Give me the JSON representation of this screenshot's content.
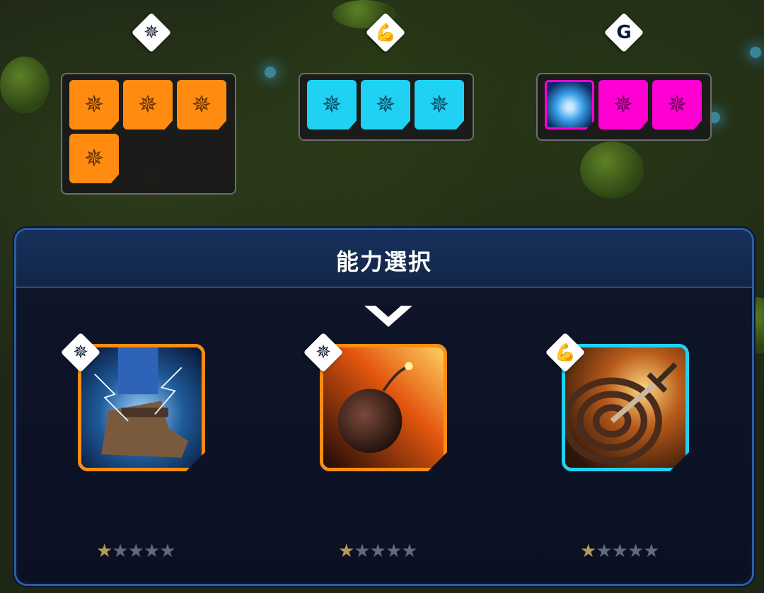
{
  "top_groups": [
    {
      "badge_icon": "shuriken-icon",
      "badge_glyph": "✵",
      "tiles": [
        "orange",
        "orange",
        "orange",
        "orange"
      ],
      "tile_glyph": "✵"
    },
    {
      "badge_icon": "muscle-arm-icon",
      "badge_glyph": "💪",
      "tiles": [
        "cyan",
        "cyan",
        "cyan"
      ],
      "tile_glyph": "✵"
    },
    {
      "badge_icon": "spiral-g-icon",
      "badge_glyph": "G",
      "tiles": [
        "crystal",
        "magenta",
        "magenta"
      ],
      "tile_glyph": "✵"
    }
  ],
  "panel": {
    "title": "能力選択"
  },
  "abilities": [
    {
      "name": "lightning-boots",
      "category_icon": "shuriken-icon",
      "badge_glyph": "✵",
      "border": "orange",
      "stars_filled": 1,
      "stars_total": 5
    },
    {
      "name": "fire-bomb",
      "category_icon": "shuriken-icon",
      "badge_glyph": "✵",
      "border": "orange",
      "stars_filled": 1,
      "stars_total": 5,
      "selected": true
    },
    {
      "name": "dagger-target",
      "category_icon": "muscle-arm-icon",
      "badge_glyph": "💪",
      "border": "cyan",
      "stars_filled": 1,
      "stars_total": 5
    }
  ],
  "star_glyph": "★",
  "colors": {
    "orange": "#ff8c11",
    "cyan": "#1fd2f3",
    "magenta": "#ff00d2",
    "panel_border": "#2a5ea5"
  }
}
